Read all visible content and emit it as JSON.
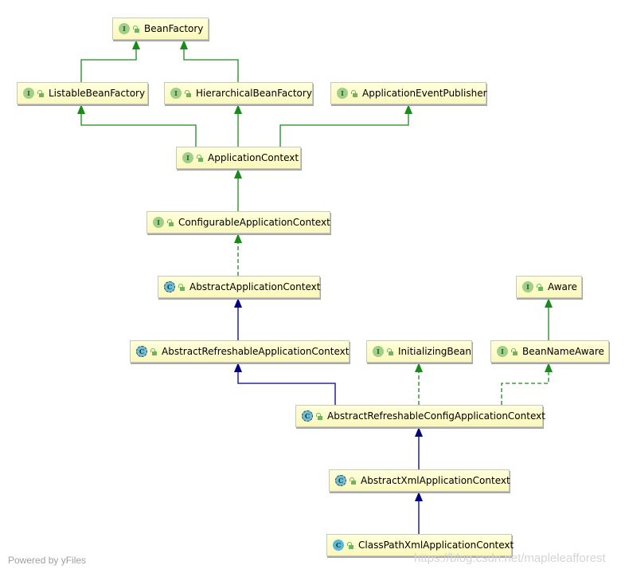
{
  "colors": {
    "interface_edge": "#1a8a1a",
    "class_edge": "#000080",
    "node_fill": "#fdfbc9"
  },
  "nodes": [
    {
      "id": "BeanFactory",
      "label": "BeanFactory",
      "kind": "interface"
    },
    {
      "id": "ListableBeanFactory",
      "label": "ListableBeanFactory",
      "kind": "interface"
    },
    {
      "id": "HierarchicalBeanFactory",
      "label": "HierarchicalBeanFactory",
      "kind": "interface"
    },
    {
      "id": "ApplicationEventPublisher",
      "label": "ApplicationEventPublisher",
      "kind": "interface"
    },
    {
      "id": "ApplicationContext",
      "label": "ApplicationContext",
      "kind": "interface"
    },
    {
      "id": "ConfigurableApplicationContext",
      "label": "ConfigurableApplicationContext",
      "kind": "interface"
    },
    {
      "id": "AbstractApplicationContext",
      "label": "AbstractApplicationContext",
      "kind": "abstract"
    },
    {
      "id": "Aware",
      "label": "Aware",
      "kind": "interface"
    },
    {
      "id": "AbstractRefreshableApplicationContext",
      "label": "AbstractRefreshableApplicationContext",
      "kind": "abstract"
    },
    {
      "id": "InitializingBean",
      "label": "InitializingBean",
      "kind": "interface"
    },
    {
      "id": "BeanNameAware",
      "label": "BeanNameAware",
      "kind": "interface"
    },
    {
      "id": "AbstractRefreshableConfigApplicationContext",
      "label": "AbstractRefreshableConfigApplicationContext",
      "kind": "abstract"
    },
    {
      "id": "AbstractXmlApplicationContext",
      "label": "AbstractXmlApplicationContext",
      "kind": "abstract"
    },
    {
      "id": "ClassPathXmlApplicationContext",
      "label": "ClassPathXmlApplicationContext",
      "kind": "class"
    }
  ],
  "edges": [
    {
      "from": "ListableBeanFactory",
      "to": "BeanFactory",
      "type": "interface-extends"
    },
    {
      "from": "HierarchicalBeanFactory",
      "to": "BeanFactory",
      "type": "interface-extends"
    },
    {
      "from": "ApplicationContext",
      "to": "ListableBeanFactory",
      "type": "interface-extends"
    },
    {
      "from": "ApplicationContext",
      "to": "HierarchicalBeanFactory",
      "type": "interface-extends"
    },
    {
      "from": "ApplicationContext",
      "to": "ApplicationEventPublisher",
      "type": "interface-extends"
    },
    {
      "from": "ConfigurableApplicationContext",
      "to": "ApplicationContext",
      "type": "interface-extends"
    },
    {
      "from": "AbstractApplicationContext",
      "to": "ConfigurableApplicationContext",
      "type": "implements"
    },
    {
      "from": "AbstractRefreshableApplicationContext",
      "to": "AbstractApplicationContext",
      "type": "extends"
    },
    {
      "from": "BeanNameAware",
      "to": "Aware",
      "type": "interface-extends"
    },
    {
      "from": "AbstractRefreshableConfigApplicationContext",
      "to": "AbstractRefreshableApplicationContext",
      "type": "extends"
    },
    {
      "from": "AbstractRefreshableConfigApplicationContext",
      "to": "InitializingBean",
      "type": "implements"
    },
    {
      "from": "AbstractRefreshableConfigApplicationContext",
      "to": "BeanNameAware",
      "type": "implements"
    },
    {
      "from": "AbstractXmlApplicationContext",
      "to": "AbstractRefreshableConfigApplicationContext",
      "type": "extends"
    },
    {
      "from": "ClassPathXmlApplicationContext",
      "to": "AbstractXmlApplicationContext",
      "type": "extends"
    }
  ],
  "badges": {
    "interface": "I",
    "abstract": "C",
    "class": "C"
  },
  "footer": {
    "powered_by": "Powered by yFiles",
    "watermark": "https://blog.csdn.net/mapleleafforest"
  }
}
